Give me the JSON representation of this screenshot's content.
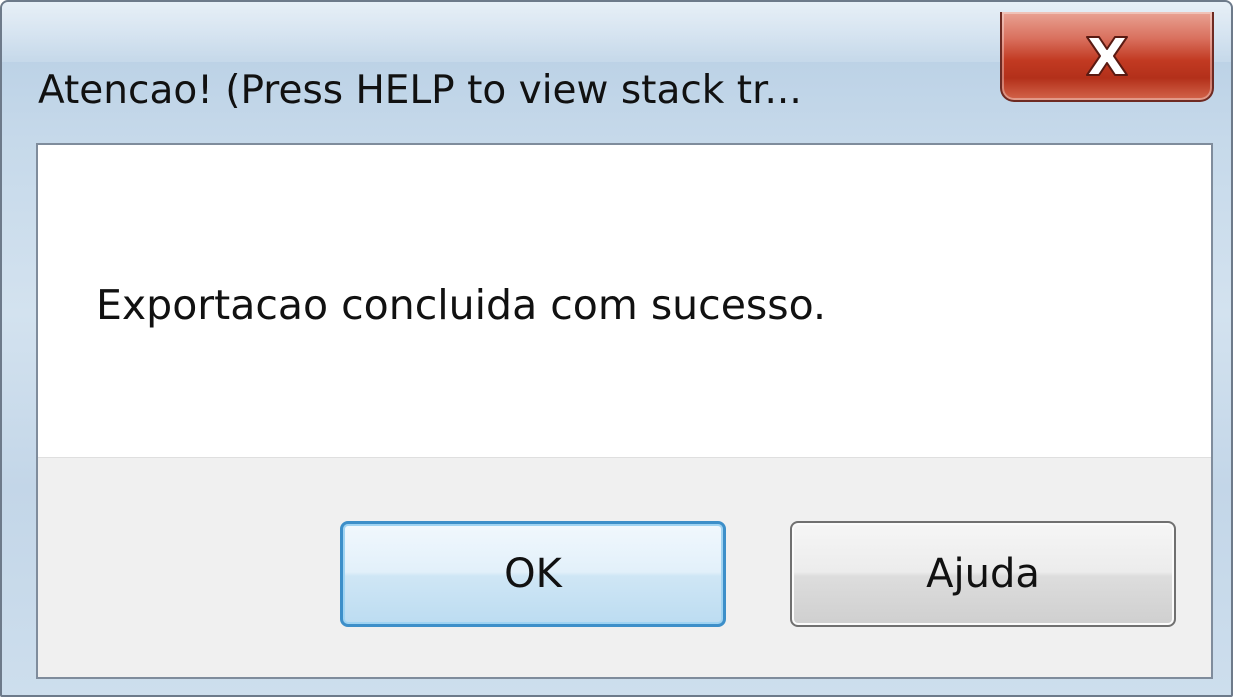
{
  "window": {
    "title": "Atencao! (Press HELP to view stack tr...",
    "close_icon": "close-icon"
  },
  "dialog": {
    "message": "Exportacao concluida com sucesso."
  },
  "buttons": {
    "ok_label": "OK",
    "help_label": "Ajuda"
  },
  "colors": {
    "close_button": "#c23a22",
    "default_button_border": "#3d8fc9",
    "frame": "#c6d9ea"
  }
}
